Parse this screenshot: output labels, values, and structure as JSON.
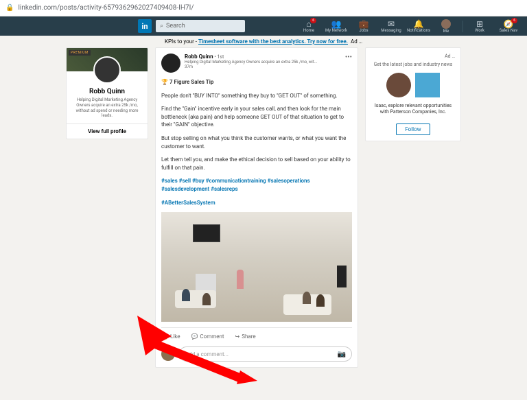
{
  "url": "linkedin.com/posts/activity-6579362962027409408-IH7I/",
  "search": {
    "placeholder": "Search"
  },
  "nav": {
    "home": "Home",
    "network": "My Network",
    "jobs": "Jobs",
    "messaging": "Messaging",
    "notifications": "Notifications",
    "me": "Me",
    "work": "Work",
    "salesnav": "Sales Nav",
    "home_badge": "6",
    "salesnav_badge": "6"
  },
  "adline": {
    "prefix": "KPIs to ",
    "mid": "your ",
    "link": "Timesheet software with the best analytics. Try now for free.",
    "tag": "Ad"
  },
  "profile": {
    "premium": "PREMIUM",
    "name": "Robb Quinn",
    "desc": "Helping Digital Marketing Agency Owners acquire an extra 25k /mo, without ad spend or needing more leads.",
    "view": "View full profile"
  },
  "post": {
    "author": "Robb Quinn",
    "degree": "• 1st",
    "headline": "Helping Digital Marketing Agency Owners acquire an extra 25k /mo, wit...",
    "time": "37m",
    "menu": "•••",
    "tip_icon": "🏆",
    "tip_title": "7 Figure Sales Tip",
    "p1": "People don't \"BUY INTO\" something they buy to \"GET OUT\" of something.",
    "p2": "Find the \"Gain\" incentive early in your sales call, and then look for the main bottleneck (aka pain) and help someone GET OUT of that situation to get to their \"GAIN\" objective.",
    "p3": "But stop selling on what you think the customer wants, or what you want the customer to want.",
    "p4": "Let them tell you, and make the ethical decision to sell based on your ability to fulfill on that pain.",
    "hashtags1": "#sales #sell #buy #communicationtraining #salesoperations #salesdevelopment #salesreps",
    "hashtags2": "#ABetterSalesSystem",
    "like": "Like",
    "comment": "Comment",
    "share": "Share",
    "comment_placeholder": "Add a comment..."
  },
  "rightad": {
    "label": "Ad …",
    "head": "Get the latest jobs and industry news",
    "text": "Isaac, explore relevant opportunities with Patterson Companies, Inc.",
    "follow": "Follow"
  }
}
